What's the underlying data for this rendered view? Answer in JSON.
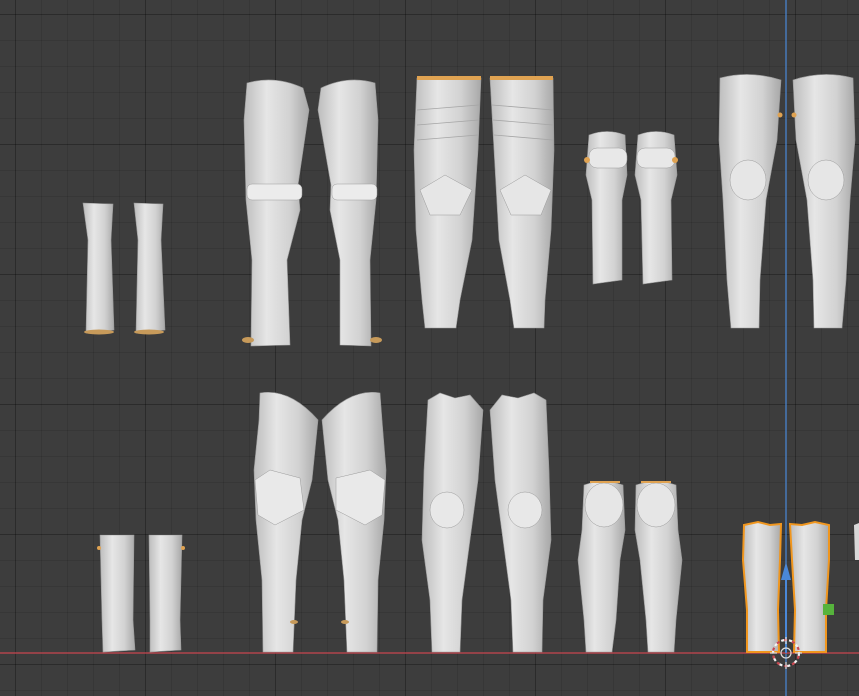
{
  "viewport": {
    "type": "3d-viewport",
    "background": "#3d3d3d",
    "mesh_color": "#d4d4d4",
    "mesh_shadow": "#a9a9a9",
    "accent_orange": "#e0a352",
    "selection_outline": "#f0961e",
    "axis_x_color": "#c8464f",
    "axis_z_color": "#4a88d8",
    "gizmo_handle_color": "#56b33c"
  },
  "objects": {
    "rows": 2,
    "items_per_row": 5,
    "selected": "leg-armor-row2-item5"
  }
}
